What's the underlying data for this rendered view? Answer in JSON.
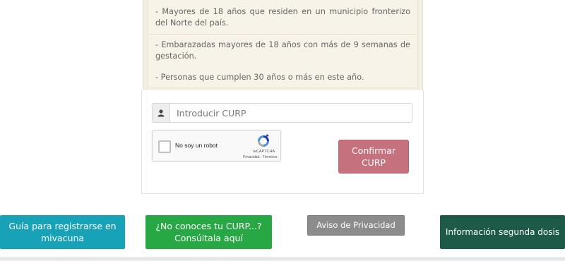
{
  "requirements": {
    "item1": "- Mayores de 18 años que residen en un municipio fronterizo del Norte del país.",
    "item2": "- Embarazadas mayores de 18 años con más de 9 semanas de gestación.",
    "item3": "- Personas que cumplen 30 años o más en este año."
  },
  "form": {
    "curp_placeholder": "Introducir CURP",
    "curp_value": "",
    "user_icon": "user-icon",
    "confirm_label": "Confirmar CURP",
    "confirm_color": "#c6727e"
  },
  "recaptcha": {
    "checkbox_label": "No soy un robot",
    "brand": "reCAPTCHA",
    "privacy": "Privacidad",
    "separator": " - ",
    "terms": "Términos",
    "logo_icon": "recaptcha-logo-icon"
  },
  "bottom_buttons": {
    "guide": "Guía para registrarse en mivacuna",
    "curp_lookup": "¿No conoces tu CURP...? Consúltala aquí",
    "privacy_notice": "Aviso de Privacidad",
    "second_dose": "Información segunda dosis"
  },
  "colors": {
    "guide": "#17a2b8",
    "curp_lookup": "#28a745",
    "privacy_notice": "#8c8c8c",
    "second_dose": "#1d5a47",
    "info_background": "#f4efe3"
  }
}
